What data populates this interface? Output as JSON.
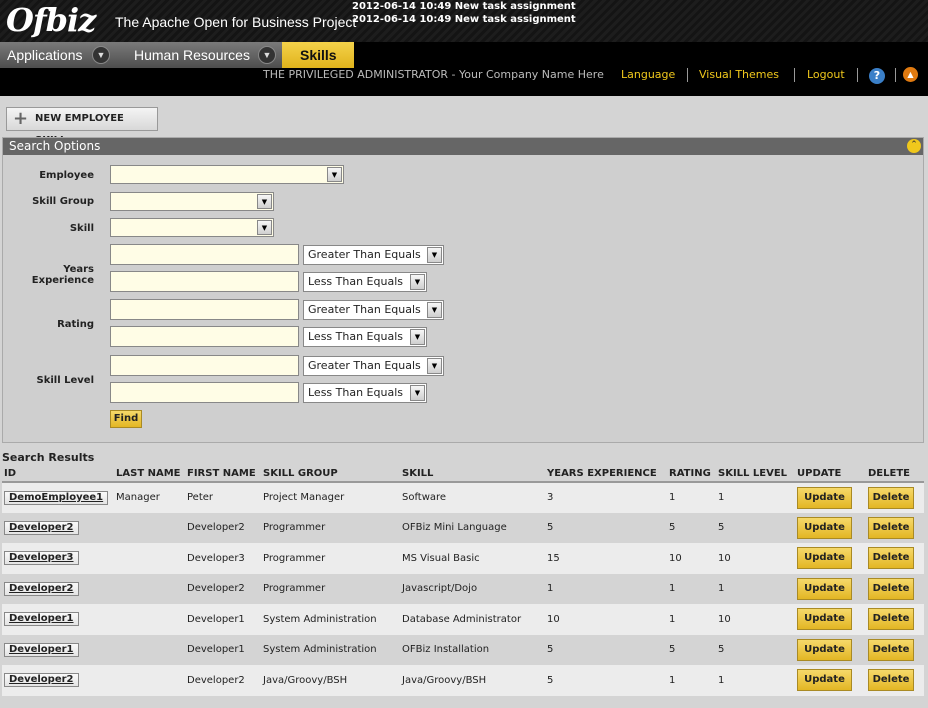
{
  "header": {
    "logo": "Ofbiz",
    "tagline": "The Apache Open for Business Project",
    "messages": [
      "2012-06-14 10:49 New task assignment",
      "2012-06-14 10:49 New task assignment"
    ]
  },
  "tabs": [
    {
      "label": "Applications"
    },
    {
      "label": "Human Resources"
    },
    {
      "label": "Skills"
    }
  ],
  "utilbar": {
    "user": "THE PRIVILEGED ADMINISTRATOR - Your Company Name Here",
    "language": "Language",
    "visual_themes": "Visual Themes",
    "logout": "Logout",
    "help": "?"
  },
  "actions": {
    "new_skill": "NEW EMPLOYEE SKILL"
  },
  "search": {
    "title": "Search Options",
    "labels": {
      "employee": "Employee",
      "skill_group": "Skill Group",
      "skill": "Skill",
      "years_experience": "Years Experience",
      "rating": "Rating",
      "skill_level": "Skill Level"
    },
    "op_gte": "Greater Than Equals",
    "op_lte": "Less Than Equals",
    "find": "Find"
  },
  "results": {
    "title": "Search Results",
    "columns": [
      "ID",
      "LAST NAME",
      "FIRST NAME",
      "SKILL GROUP",
      "SKILL",
      "YEARS EXPERIENCE",
      "RATING",
      "SKILL LEVEL",
      "UPDATE",
      "DELETE"
    ],
    "update_label": "Update",
    "delete_label": "Delete",
    "rows": [
      {
        "id": "DemoEmployee1",
        "last": "Manager",
        "first": "Peter",
        "group": "Project Manager",
        "skill": "Software",
        "years": "3",
        "rating": "1",
        "level": "1"
      },
      {
        "id": "Developer2",
        "last": "",
        "first": "Developer2",
        "group": "Programmer",
        "skill": "OFBiz Mini Language",
        "years": "5",
        "rating": "5",
        "level": "5"
      },
      {
        "id": "Developer3",
        "last": "",
        "first": "Developer3",
        "group": "Programmer",
        "skill": "MS Visual Basic",
        "years": "15",
        "rating": "10",
        "level": "10"
      },
      {
        "id": "Developer2",
        "last": "",
        "first": "Developer2",
        "group": "Programmer",
        "skill": "Javascript/Dojo",
        "years": "1",
        "rating": "1",
        "level": "1"
      },
      {
        "id": "Developer1",
        "last": "",
        "first": "Developer1",
        "group": "System Administration",
        "skill": "Database Administrator",
        "years": "10",
        "rating": "1",
        "level": "10"
      },
      {
        "id": "Developer1",
        "last": "",
        "first": "Developer1",
        "group": "System Administration",
        "skill": "OFBiz Installation",
        "years": "5",
        "rating": "5",
        "level": "5"
      },
      {
        "id": "Developer2",
        "last": "",
        "first": "Developer2",
        "group": "Java/Groovy/BSH",
        "skill": "Java/Groovy/BSH",
        "years": "5",
        "rating": "1",
        "level": "1"
      }
    ]
  },
  "colors": {
    "accent": "#f0c81c",
    "header_bg": "#000000",
    "panel_bg": "#cfcfcf"
  }
}
